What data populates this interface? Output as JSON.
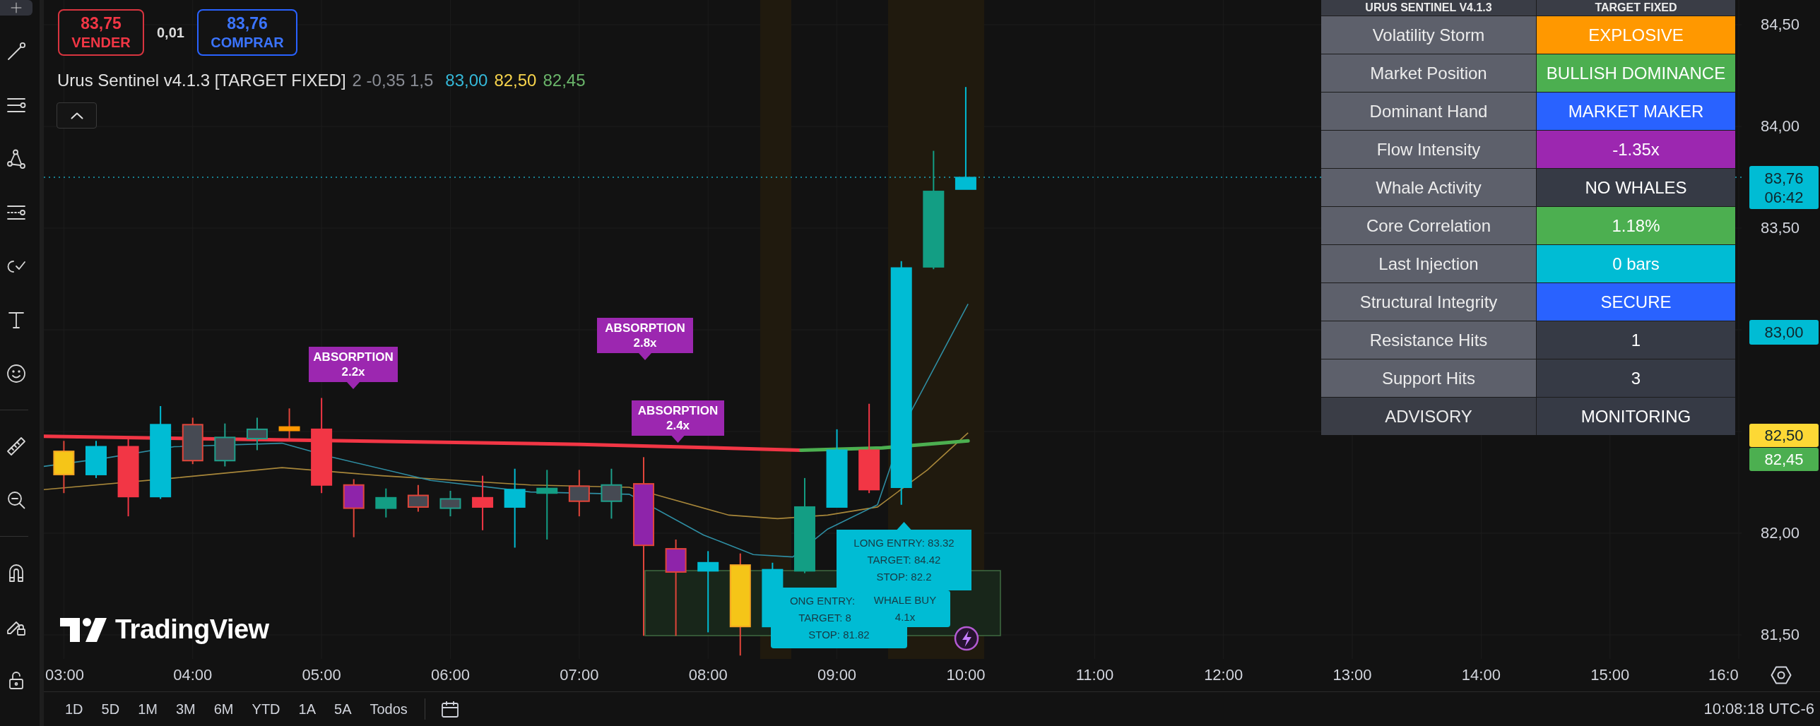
{
  "left_toolbar": {
    "tools": [
      {
        "selected": true
      },
      {
        "selected": false
      },
      {
        "selected": false
      },
      {
        "selected": false
      },
      {
        "selected": false
      },
      {
        "selected": false
      },
      {
        "selected": false
      },
      {
        "selected": false
      },
      {
        "selected": false
      },
      {
        "selected": false
      },
      {
        "selected": false
      },
      {
        "selected": false
      },
      {
        "selected": false
      }
    ]
  },
  "trade_panel": {
    "sell": {
      "price": "83,75",
      "label": "VENDER"
    },
    "spread": "0,01",
    "buy": {
      "price": "83,76",
      "label": "COMPRAR"
    }
  },
  "indicator_legend": {
    "name": "Urus Sentinel v4.1.3 [TARGET FIXED]",
    "params": "2 -0,35 1,5",
    "values": [
      {
        "text": "83,00",
        "color": "#35b8d8"
      },
      {
        "text": "82,50",
        "color": "#f7d44c"
      },
      {
        "text": "82,45",
        "color": "#6ab56a"
      }
    ]
  },
  "dashboard": {
    "header": [
      "URUS SENTINEL V4.1.3",
      "TARGET FIXED"
    ],
    "rows": [
      {
        "kind": "metric",
        "label": "Volatility Storm",
        "value": "EXPLOSIVE",
        "color": "#ff9800"
      },
      {
        "kind": "metric",
        "label": "Market Position",
        "value": "BULLISH DOMINANCE",
        "color": "#4caf50"
      },
      {
        "kind": "metric",
        "label": "Dominant Hand",
        "value": "MARKET MAKER",
        "color": "#2962ff"
      },
      {
        "kind": "metric",
        "label": "Flow Intensity",
        "value": "-1.35x",
        "color": "#9c27b0"
      },
      {
        "kind": "metric",
        "label": "Whale Activity",
        "value": "NO WHALES",
        "color": "#363a45"
      },
      {
        "kind": "metric",
        "label": "Core Correlation",
        "value": "1.18%",
        "color": "#4caf50"
      },
      {
        "kind": "metric",
        "label": "Last Injection",
        "value": "0 bars",
        "color": "#00bcd4"
      },
      {
        "kind": "metric",
        "label": "Structural Integrity",
        "value": "SECURE",
        "color": "#2962ff"
      },
      {
        "kind": "metric",
        "label": "Resistance Hits",
        "value": "1",
        "color": "#363a45"
      },
      {
        "kind": "metric",
        "label": "Support Hits",
        "value": "3",
        "color": "#363a45"
      },
      {
        "kind": "advisory",
        "label": "ADVISORY",
        "value": "MONITORING",
        "color": "#363a45"
      }
    ]
  },
  "chart": {
    "annotations": [
      {
        "kind": "absorption",
        "lines": [
          "ABSORPTION",
          "2.2x"
        ]
      },
      {
        "kind": "absorption",
        "lines": [
          "ABSORPTION",
          "2.8x"
        ]
      },
      {
        "kind": "absorption",
        "lines": [
          "ABSORPTION",
          "2.4x"
        ]
      },
      {
        "kind": "entry",
        "lines": [
          "ONG ENTRY:",
          "TARGET: 8",
          "STOP: 81.82"
        ]
      },
      {
        "kind": "entry",
        "lines": [
          "LONG ENTRY: 83.32",
          "TARGET: 84.42",
          "STOP: 82.2"
        ]
      },
      {
        "kind": "whale",
        "lines": [
          "WHALE BUY",
          "4.1x"
        ]
      }
    ],
    "logo": "TradingView"
  },
  "price_axis": {
    "labels": [
      "84,50",
      "84,00",
      "83,50",
      "82,00",
      "81,50"
    ],
    "tags": [
      {
        "price": "83,76",
        "countdown": "06:42",
        "color": "#00bcd4"
      },
      {
        "price": "83,00",
        "color": "#00bcd4"
      },
      {
        "price": "82,50",
        "color": "#fdd835"
      },
      {
        "price": "82,45",
        "color": "#4caf50"
      }
    ]
  },
  "time_axis": {
    "labels": [
      "03:00",
      "04:00",
      "05:00",
      "06:00",
      "07:00",
      "08:00",
      "09:00",
      "10:00",
      "11:00",
      "12:00",
      "13:00",
      "14:00",
      "15:00",
      "16:0"
    ]
  },
  "bottom_bar": {
    "ranges": [
      "1D",
      "5D",
      "1M",
      "3M",
      "6M",
      "YTD",
      "1A",
      "5A",
      "Todos"
    ],
    "clock": "10:08:18 UTC-6"
  }
}
